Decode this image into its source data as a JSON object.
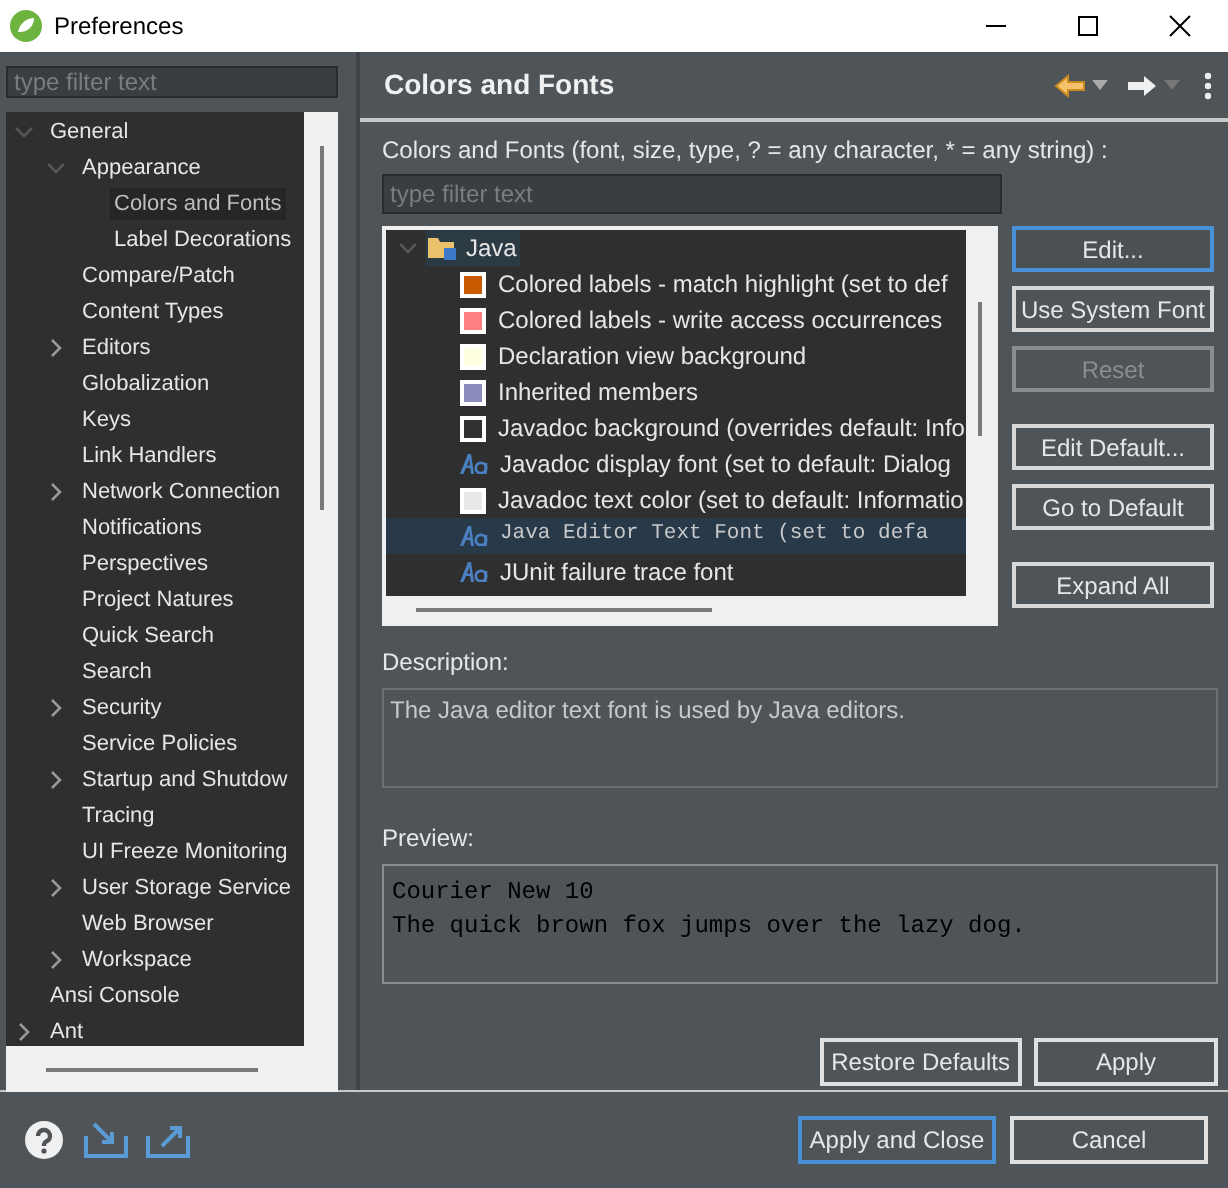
{
  "window": {
    "title": "Preferences"
  },
  "sidebar": {
    "filter_placeholder": "type filter text",
    "tree": [
      {
        "label": "General",
        "expanded": true,
        "selected": false,
        "children": [
          {
            "label": "Appearance",
            "expanded": true,
            "selected": false,
            "children": [
              {
                "label": "Colors and Fonts",
                "selected": true
              },
              {
                "label": "Label Decorations",
                "selected": false
              }
            ]
          },
          {
            "label": "Compare/Patch",
            "selected": false
          },
          {
            "label": "Content Types",
            "selected": false
          },
          {
            "label": "Editors",
            "expanded": false,
            "selected": false
          },
          {
            "label": "Globalization",
            "selected": false
          },
          {
            "label": "Keys",
            "selected": false
          },
          {
            "label": "Link Handlers",
            "selected": false
          },
          {
            "label": "Network Connection",
            "expanded": false,
            "selected": false
          },
          {
            "label": "Notifications",
            "selected": false
          },
          {
            "label": "Perspectives",
            "selected": false
          },
          {
            "label": "Project Natures",
            "selected": false
          },
          {
            "label": "Quick Search",
            "selected": false
          },
          {
            "label": "Search",
            "selected": false
          },
          {
            "label": "Security",
            "expanded": false,
            "selected": false
          },
          {
            "label": "Service Policies",
            "selected": false
          },
          {
            "label": "Startup and Shutdow",
            "expanded": false,
            "selected": false
          },
          {
            "label": "Tracing",
            "selected": false
          },
          {
            "label": "UI Freeze Monitoring",
            "selected": false
          },
          {
            "label": "User Storage Service",
            "expanded": false,
            "selected": false
          },
          {
            "label": "Web Browser",
            "selected": false
          },
          {
            "label": "Workspace",
            "expanded": false,
            "selected": false
          }
        ]
      },
      {
        "label": "Ansi Console",
        "selected": false
      },
      {
        "label": "Ant",
        "expanded": false,
        "selected": false
      }
    ]
  },
  "page": {
    "title": "Colors and Fonts",
    "filter_label": "Colors and Fonts (font, size, type, ? = any character, * = any string) :",
    "filter_placeholder": "type filter text",
    "category": {
      "label": "Java",
      "expanded": true
    },
    "entries": [
      {
        "kind": "color",
        "label": "Colored labels - match highlight (set to def",
        "color": "#c85a00",
        "selected": false
      },
      {
        "kind": "color",
        "label": "Colored labels - write access occurrences",
        "color": "#ff8080",
        "selected": false
      },
      {
        "kind": "color",
        "label": "Declaration view background",
        "color": "#ffffe1",
        "selected": false
      },
      {
        "kind": "color",
        "label": "Inherited members",
        "color": "#8c8cbf",
        "selected": false
      },
      {
        "kind": "color",
        "label": "Javadoc background (overrides default: Info",
        "color": "#2f3133",
        "selected": false
      },
      {
        "kind": "font",
        "label": "Javadoc display font (set to default: Dialog",
        "selected": false
      },
      {
        "kind": "color",
        "label": "Javadoc text color (set to default: Informatio",
        "color": "#e8e8e8",
        "selected": false
      },
      {
        "kind": "font",
        "label": "Java Editor Text Font (set to defa",
        "selected": true,
        "monospace": true
      },
      {
        "kind": "font",
        "label": "JUnit failure trace font",
        "selected": false
      }
    ],
    "side_buttons": [
      {
        "label": "Edit...",
        "disabled": false,
        "focused": true
      },
      {
        "label": "Use System Font",
        "disabled": false,
        "focused": false
      },
      {
        "label": "Reset",
        "disabled": true,
        "focused": false
      },
      {
        "label": "Edit Default...",
        "disabled": false,
        "focused": false
      },
      {
        "label": "Go to Default",
        "disabled": false,
        "focused": false
      },
      {
        "label": "Expand All",
        "disabled": false,
        "focused": false
      }
    ],
    "description_label": "Description:",
    "description": "The Java editor text font is used by Java editors.",
    "preview_label": "Preview:",
    "preview_lines": [
      "Courier New 10",
      "The quick brown fox jumps over the lazy dog."
    ],
    "buttons": [
      "Restore Defaults",
      "Apply"
    ]
  },
  "footer": {
    "buttons": [
      {
        "label": "Apply and Close",
        "focused": true
      },
      {
        "label": "Cancel",
        "focused": false
      }
    ]
  }
}
